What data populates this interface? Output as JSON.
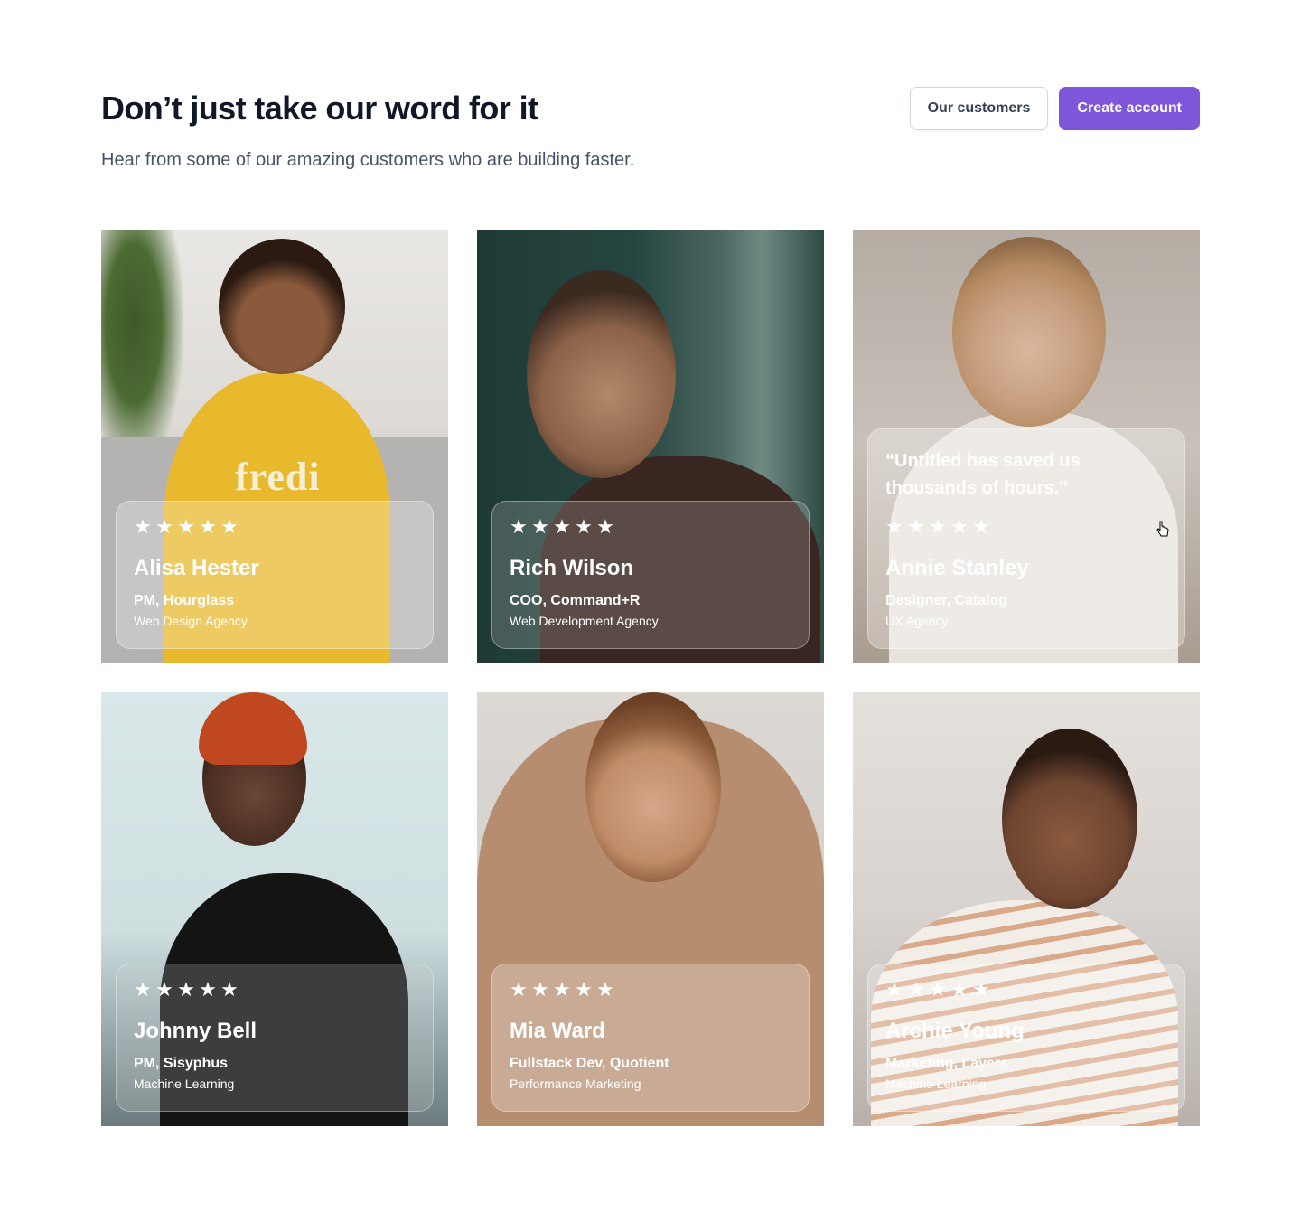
{
  "header": {
    "title": "Don’t just take our word for it",
    "subtitle": "Hear from some of our amazing customers who are building faster."
  },
  "actions": {
    "secondary_label": "Our customers",
    "primary_label": "Create account"
  },
  "colors": {
    "accent": "#7f56d9",
    "heading": "#101828",
    "body": "#475467"
  },
  "star_icon": "star-icon",
  "testimonials": [
    {
      "name": "Alisa Hester",
      "role": "PM, Hourglass",
      "company": "Web Design Agency",
      "rating": 5,
      "quote": ""
    },
    {
      "name": "Rich Wilson",
      "role": "COO, Command+R",
      "company": "Web Development Agency",
      "rating": 5,
      "quote": ""
    },
    {
      "name": "Annie Stanley",
      "role": "Designer, Catalog",
      "company": "UX Agency",
      "rating": 5,
      "quote": "“Untitled has saved us thousands of hours.”"
    },
    {
      "name": "Johnny Bell",
      "role": "PM, Sisyphus",
      "company": "Machine Learning",
      "rating": 5,
      "quote": ""
    },
    {
      "name": "Mia Ward",
      "role": "Fullstack Dev, Quotient",
      "company": "Performance Marketing",
      "rating": 5,
      "quote": ""
    },
    {
      "name": "Archie Young",
      "role": "Marketing, Layers",
      "company": "Machine Learning",
      "rating": 5,
      "quote": ""
    }
  ],
  "photo_texts": {
    "sweater_logo": "fredi"
  }
}
